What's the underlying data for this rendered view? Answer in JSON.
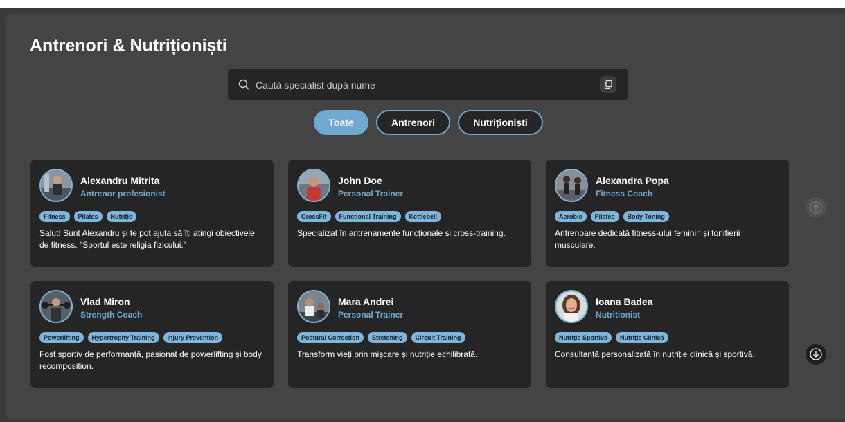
{
  "page": {
    "title": "Antrenori & Nutriționiști"
  },
  "search": {
    "placeholder": "Caută specialist după nume"
  },
  "filters": [
    {
      "label": "Toate",
      "active": true
    },
    {
      "label": "Antrenori",
      "active": false
    },
    {
      "label": "Nutriționiști",
      "active": false
    }
  ],
  "cards": [
    {
      "name": "Alexandru Mitrita",
      "role": "Antrenor profesionist",
      "tags": [
        "Fitness",
        "Pilates",
        "Nutriție"
      ],
      "description": "Salut! Sunt Alexandru și te pot ajuta să îți atingi obiectivele de fitness. \"Sportul este religia fizicului.\""
    },
    {
      "name": "John Doe",
      "role": "Personal Trainer",
      "tags": [
        "CrossFit",
        "Functional Training",
        "Kettlebell"
      ],
      "description": "Specializat în antrenamente funcționale și cross-training."
    },
    {
      "name": "Alexandra Popa",
      "role": "Fitness Coach",
      "tags": [
        "Aerobic",
        "Pilates",
        "Body Toning"
      ],
      "description": "Antrenoare dedicată fitness-ului feminin și tonifierii musculare."
    },
    {
      "name": "Vlad Miron",
      "role": "Strength Coach",
      "tags": [
        "Powerlifting",
        "Hypertrophy Training",
        "Injury Prevention"
      ],
      "description": "Fost sportiv de performanță, pasionat de powerlifting și body recomposition."
    },
    {
      "name": "Mara Andrei",
      "role": "Personal Trainer",
      "tags": [
        "Postural Correction",
        "Stretching",
        "Circuit Training"
      ],
      "description": "Transform vieți prin mișcare și nutriție echilibrată."
    },
    {
      "name": "Ioana Badea",
      "role": "Nutritionist",
      "tags": [
        "Nutriție Sportivă",
        "Nutriție Clinică"
      ],
      "description": "Consultanță personalizată în nutriție clinică și sportivă."
    }
  ],
  "icons": {
    "search": "search-icon",
    "clipboard": "clipboard-icon",
    "scroll_up": "arrow-up-circle-icon",
    "scroll_down": "arrow-down-circle-icon"
  },
  "colors": {
    "accent": "#6fa9cf",
    "card": "#252525",
    "panel": "#444444",
    "tag": "#7fb5da"
  }
}
